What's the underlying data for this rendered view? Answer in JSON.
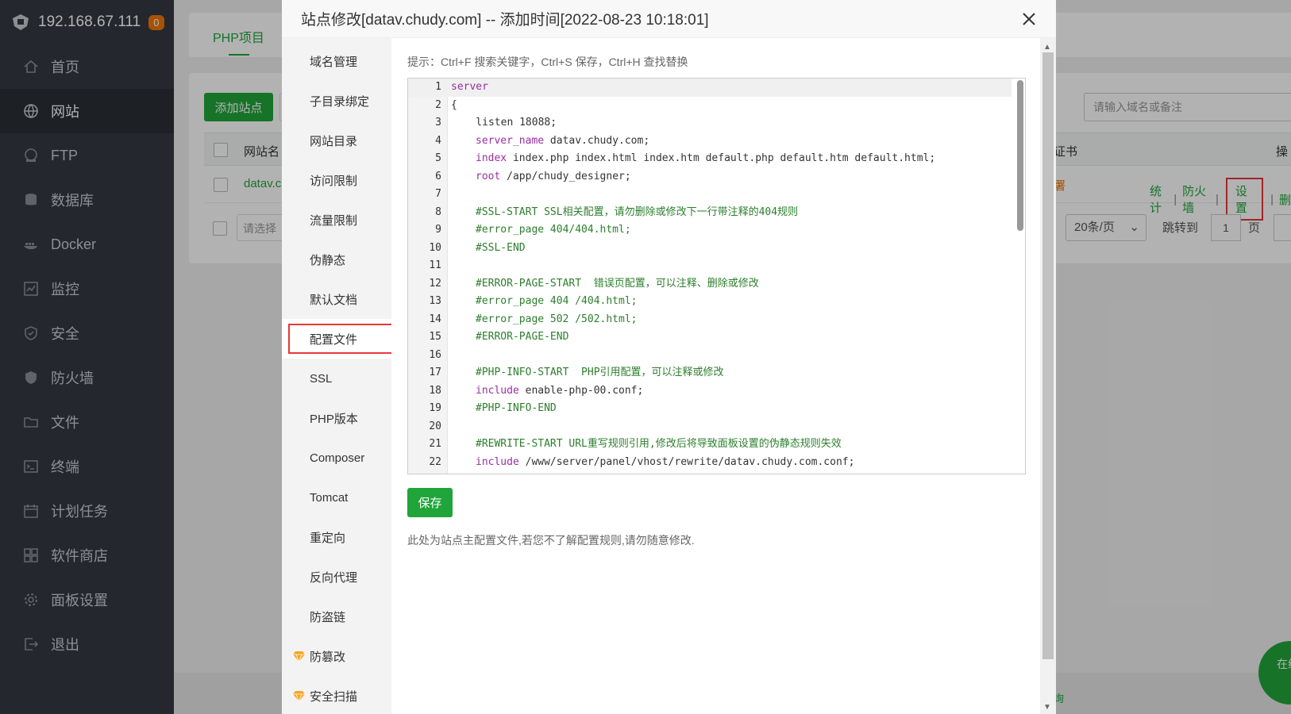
{
  "sidebar": {
    "host": "192.168.67.111",
    "badge": "0",
    "items": [
      {
        "label": "首页",
        "icon": "home-icon"
      },
      {
        "label": "网站",
        "icon": "globe-icon"
      },
      {
        "label": "FTP",
        "icon": "ftp-icon"
      },
      {
        "label": "数据库",
        "icon": "database-icon"
      },
      {
        "label": "Docker",
        "icon": "docker-icon"
      },
      {
        "label": "监控",
        "icon": "monitor-icon"
      },
      {
        "label": "安全",
        "icon": "shield-icon"
      },
      {
        "label": "防火墙",
        "icon": "firewall-icon"
      },
      {
        "label": "文件",
        "icon": "folder-icon"
      },
      {
        "label": "终端",
        "icon": "terminal-icon"
      },
      {
        "label": "计划任务",
        "icon": "calendar-icon"
      },
      {
        "label": "软件商店",
        "icon": "apps-icon"
      },
      {
        "label": "面板设置",
        "icon": "gear-icon"
      },
      {
        "label": "退出",
        "icon": "logout-icon"
      }
    ]
  },
  "background": {
    "tab": "PHP项目",
    "add_site": "添加站点",
    "search_placeholder": "请输入域名或备注",
    "col_site": "网站名",
    "col_cert": "证书",
    "col_op": "操",
    "site_name": "datav.c",
    "cert_fragment": "署",
    "batch_placeholder": "请选择",
    "actions": {
      "stats": "统计",
      "firewall": "防火墙",
      "settings": "设置",
      "delete": "删"
    },
    "page_size": "20条/页",
    "jump_to": "跳转到",
    "page_num": "1",
    "page_unit": "页",
    "online_service": "在线客服",
    "bottom_fragment": "询"
  },
  "modal": {
    "title": "站点修改[datav.chudy.com] -- 添加时间[2022-08-23 10:18:01]",
    "menu": [
      {
        "label": "域名管理"
      },
      {
        "label": "子目录绑定"
      },
      {
        "label": "网站目录"
      },
      {
        "label": "访问限制"
      },
      {
        "label": "流量限制"
      },
      {
        "label": "伪静态"
      },
      {
        "label": "默认文档"
      },
      {
        "label": "配置文件"
      },
      {
        "label": "SSL"
      },
      {
        "label": "PHP版本"
      },
      {
        "label": "Composer"
      },
      {
        "label": "Tomcat"
      },
      {
        "label": "重定向"
      },
      {
        "label": "反向代理"
      },
      {
        "label": "防盗链"
      },
      {
        "label": "防篡改"
      },
      {
        "label": "安全扫描"
      }
    ],
    "hint": "提示：Ctrl+F 搜索关键字，Ctrl+S 保存，Ctrl+H 查找替换",
    "save_label": "保存",
    "note": "此处为站点主配置文件,若您不了解配置规则,请勿随意修改.",
    "code_lines": [
      "1",
      "2",
      "3",
      "4",
      "5",
      "6",
      "7",
      "8",
      "9",
      "10",
      "11",
      "12",
      "13",
      "14",
      "15",
      "16",
      "17",
      "18",
      "19",
      "20",
      "21",
      "22"
    ],
    "code": {
      "l1": "server",
      "l2": "{",
      "l3": "    listen 18088;",
      "l4_kw": "server_name",
      "l4_rest": " datav.chudy.com;",
      "l5_kw": "index",
      "l5_rest": " index.php index.html index.htm default.php default.htm default.html;",
      "l6_kw": "root",
      "l6_rest": " /app/chudy_designer;",
      "l8": "#SSL-START SSL相关配置，请勿删除或修改下一行带注释的404规则",
      "l9": "#error_page 404/404.html;",
      "l10": "#SSL-END",
      "l12": "#ERROR-PAGE-START  错误页配置，可以注释、删除或修改",
      "l13": "#error_page 404 /404.html;",
      "l14": "#error_page 502 /502.html;",
      "l15": "#ERROR-PAGE-END",
      "l17": "#PHP-INFO-START  PHP引用配置，可以注释或修改",
      "l18_kw": "include",
      "l18_rest": " enable-php-00.conf;",
      "l19": "#PHP-INFO-END",
      "l21": "#REWRITE-START URL重写规则引用,修改后将导致面板设置的伪静态规则失效",
      "l22_kw": "include",
      "l22_rest": " /www/server/panel/vhost/rewrite/datav.chudy.com.conf;"
    }
  },
  "colors": {
    "accent": "#20a53a",
    "highlight": "#e8373a",
    "sidebar": "#343a43"
  }
}
